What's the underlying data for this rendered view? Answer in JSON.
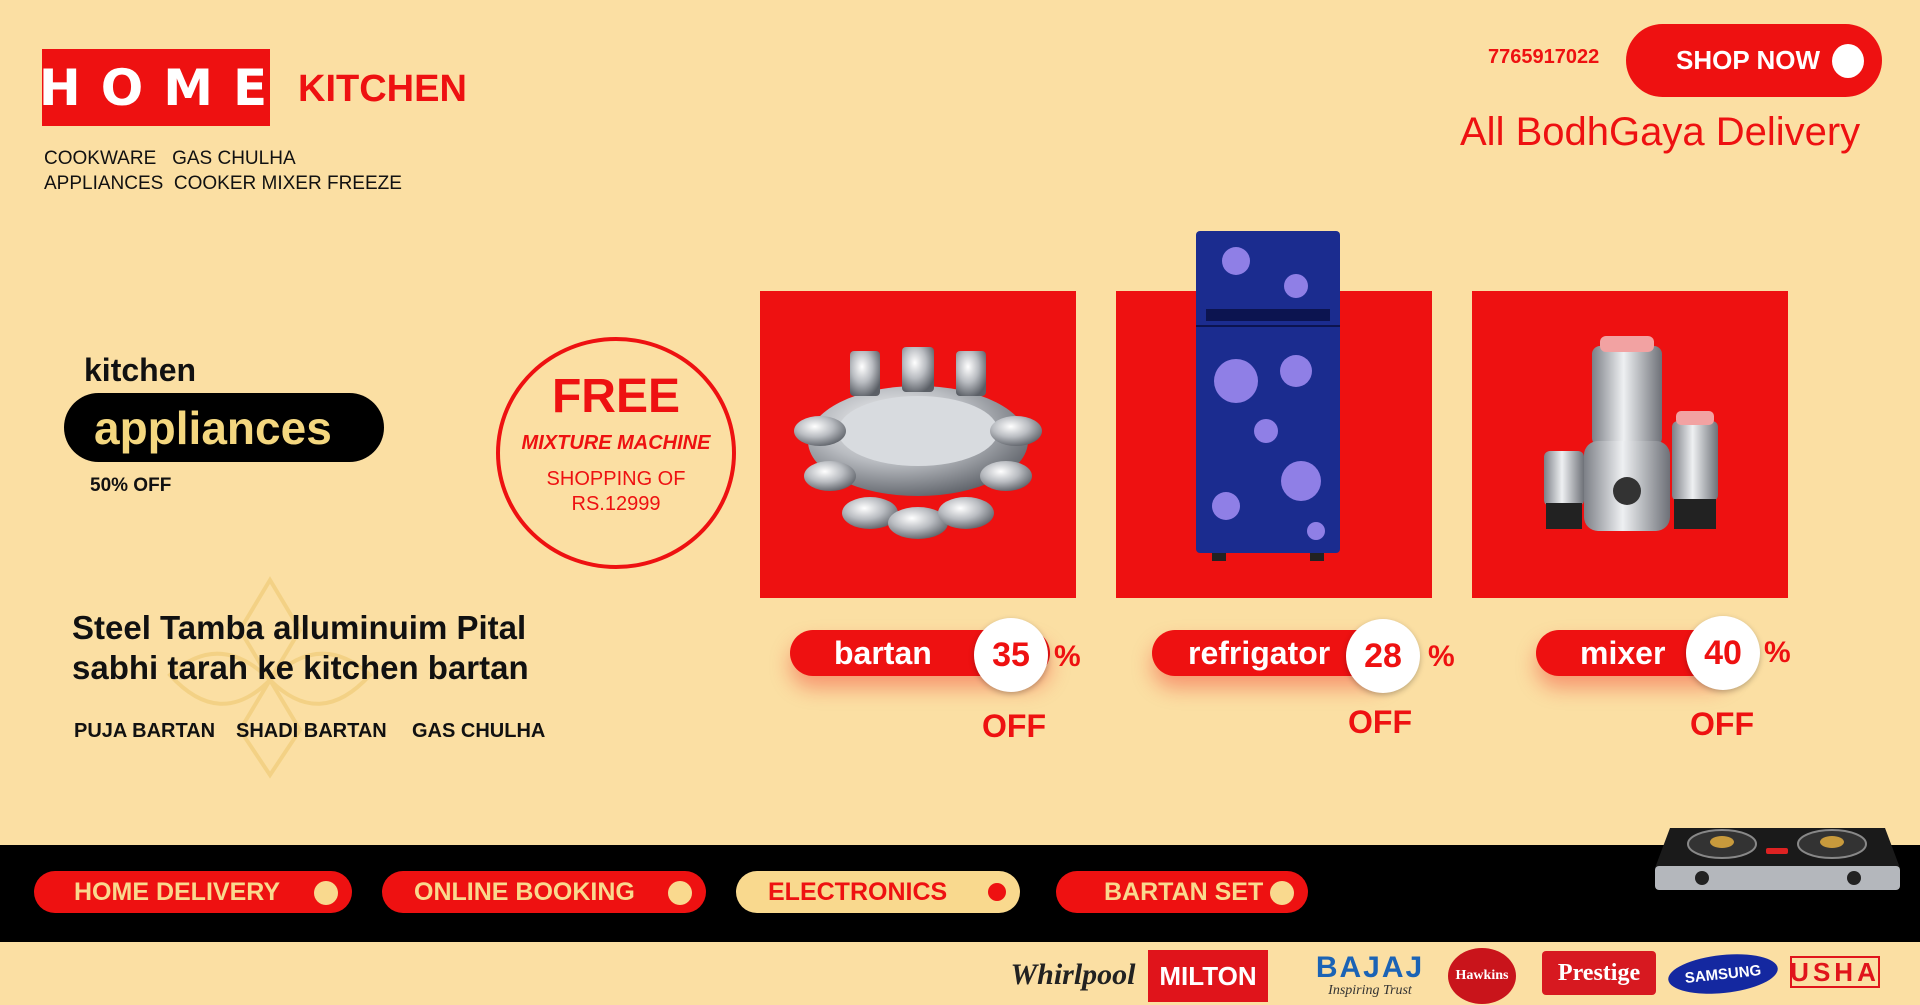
{
  "header": {
    "logo_main": "HOME",
    "logo_sub": "KITCHEN",
    "categories_line1": "COOKWARE   GAS CHULHA",
    "categories_line2": "APPLIANCES  COOKER MIXER FREEZE",
    "phone": "7765917022",
    "shop_now": "SHOP NOW",
    "delivery": "All BodhGaya Delivery"
  },
  "promo": {
    "kitchen": "kitchen",
    "appliances": "appliances",
    "discount": "50% OFF",
    "free": "FREE",
    "free_item": "MIXTURE MACHINE",
    "free_condition_1": "SHOPPING OF",
    "free_condition_2": "RS.12999",
    "tagline_1": "Steel Tamba alluminuim Pital",
    "tagline_2": "sabhi tarah ke kitchen bartan",
    "tags": [
      "PUJA BARTAN",
      "SHADI BARTAN",
      "GAS CHULHA"
    ]
  },
  "products": [
    {
      "name": "bartan",
      "percent": "35",
      "percent_sign": "%",
      "off": "OFF",
      "icon": "utensils-set-image"
    },
    {
      "name": "refrigator",
      "percent": "28",
      "percent_sign": "%",
      "off": "OFF",
      "icon": "refrigerator-image"
    },
    {
      "name": "mixer",
      "percent": "40",
      "percent_sign": "%",
      "off": "OFF",
      "icon": "mixer-grinder-image"
    }
  ],
  "nav": [
    {
      "label": "HOME DELIVERY"
    },
    {
      "label": "ONLINE BOOKING"
    },
    {
      "label": "ELECTRONICS"
    },
    {
      "label": "BARTAN SET"
    }
  ],
  "brands": {
    "whirlpool": "Whirlpool",
    "milton": "MILTON",
    "bajaj": "BAJAJ",
    "bajaj_tag": "Inspiring Trust",
    "hawkins": "Hawkins",
    "prestige": "Prestige",
    "samsung": "SAMSUNG",
    "usha": "USHA"
  },
  "colors": {
    "background": "#fbdfa3",
    "accent_red": "#ee1111",
    "black": "#000000",
    "cream": "#f9d98e"
  }
}
